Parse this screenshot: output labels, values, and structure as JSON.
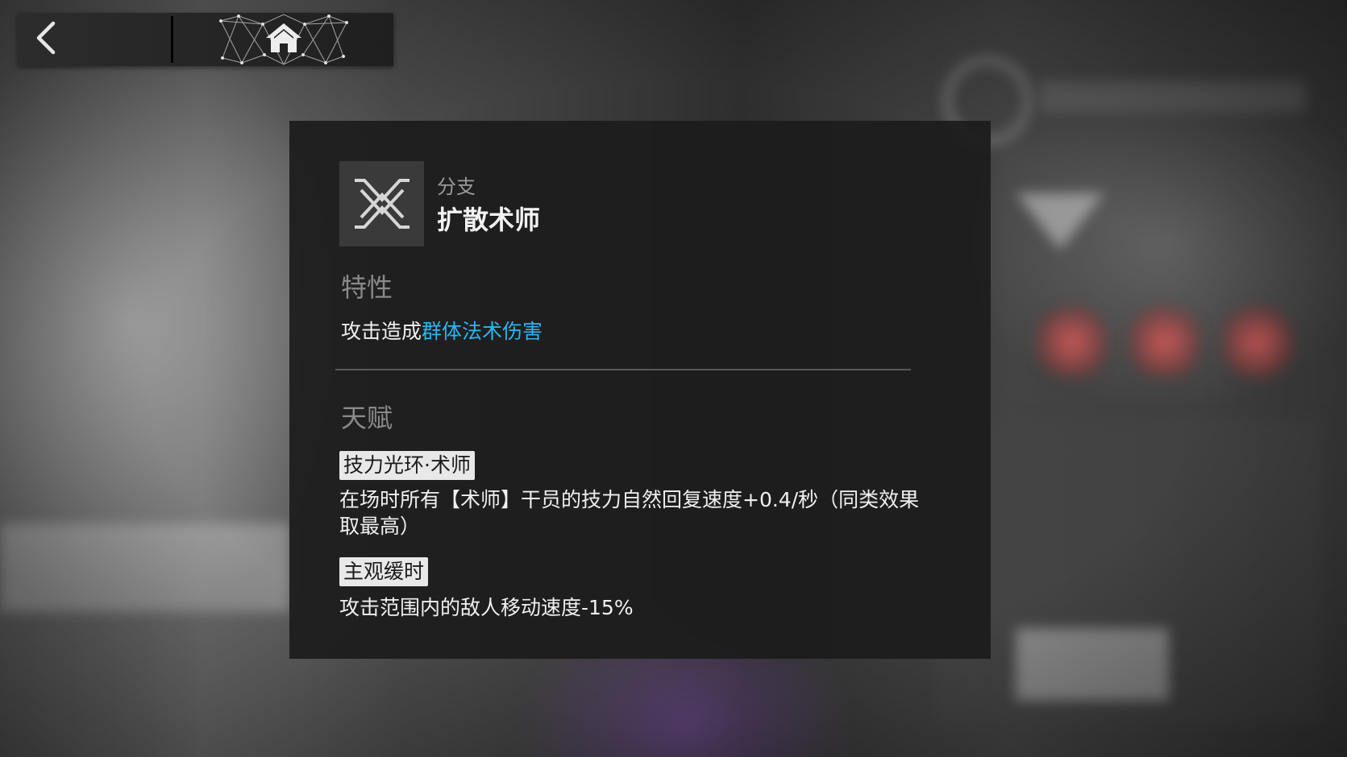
{
  "nav": {
    "back_icon": "chevron-left-icon",
    "home_icon": "home-icon"
  },
  "branch": {
    "icon": "splash-caster-branch-icon",
    "caption": "分支",
    "name": "扩散术师"
  },
  "trait": {
    "heading": "特性",
    "text_plain": "攻击造成",
    "text_highlight": "群体法术伤害",
    "highlight_color": "#29b6f6"
  },
  "talents": {
    "heading": "天赋",
    "items": [
      {
        "name": "技力光环·术师",
        "description": "在场时所有【术师】干员的技力自然回复速度+0.4/秒（同类效果取最高）"
      },
      {
        "name": "主观缓时",
        "description": "攻击范围内的敌人移动速度-15%"
      }
    ]
  }
}
